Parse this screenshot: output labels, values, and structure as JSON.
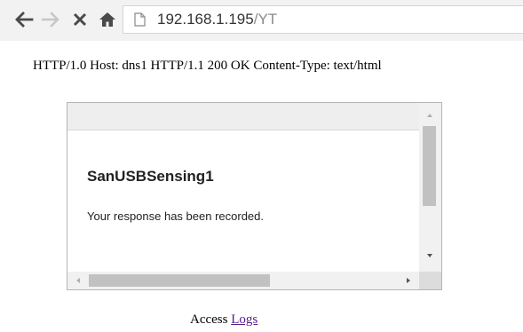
{
  "browser": {
    "back_icon": "arrow-left-icon",
    "forward_icon": "arrow-right-icon",
    "stop_icon": "close-icon",
    "home_icon": "home-icon",
    "page_icon": "page-icon",
    "url_host": "192.168.1.195",
    "url_path": "/YT"
  },
  "page": {
    "http_line": "HTTP/1.0 Host: dns1 HTTP/1.1 200 OK Content-Type: text/html",
    "frame": {
      "form_title": "SanUSBSensing1",
      "message": "Your response has been recorded."
    },
    "access_text": "Access",
    "logs_link": "Logs"
  },
  "colors": {
    "toolbar_bg": "#f2f2f2",
    "visited_link": "#551a8b"
  }
}
